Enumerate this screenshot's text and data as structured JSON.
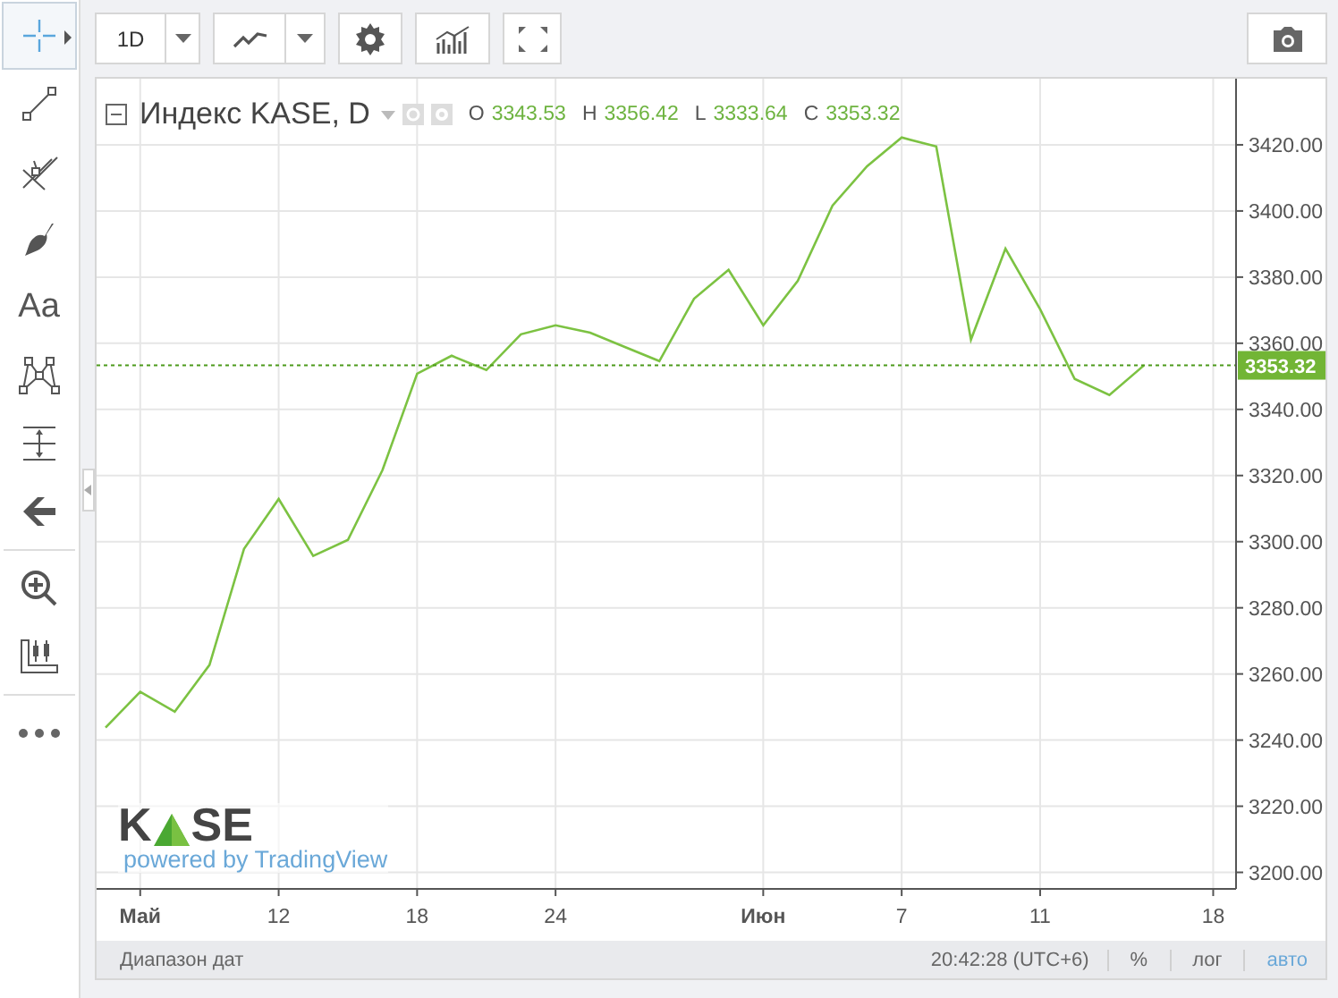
{
  "drawing_tools": [
    {
      "kind": "crosshair",
      "selected": true
    },
    {
      "kind": "trend-line",
      "selected": false
    },
    {
      "kind": "pitchfork",
      "selected": false
    },
    {
      "kind": "brush",
      "selected": false
    },
    {
      "kind": "text",
      "label": "Aa",
      "selected": false
    },
    {
      "kind": "pattern",
      "selected": false
    },
    {
      "kind": "measure",
      "selected": false
    },
    {
      "kind": "arrow",
      "selected": false
    },
    {
      "kind": "separator"
    },
    {
      "kind": "zoom",
      "selected": false
    },
    {
      "kind": "candle-ruler",
      "selected": false
    },
    {
      "kind": "separator"
    },
    {
      "kind": "more",
      "selected": false
    }
  ],
  "toolbar": {
    "interval": "1D"
  },
  "legend": {
    "title": "Индекс KASE, D",
    "ohlc": [
      {
        "label": "O",
        "value": "3343.53"
      },
      {
        "label": "H",
        "value": "3356.42"
      },
      {
        "label": "L",
        "value": "3333.64"
      },
      {
        "label": "C",
        "value": "3353.32"
      }
    ]
  },
  "logo": {
    "left": "K",
    "right": "SE",
    "tagline": "powered by TradingView"
  },
  "chart": {
    "chart_data": {
      "type": "line",
      "categories": [
        null,
        "Май",
        null,
        null,
        null,
        "12",
        null,
        null,
        null,
        "18",
        null,
        null,
        null,
        "24",
        null,
        null,
        null,
        null,
        null,
        "Июн",
        null,
        null,
        null,
        "7",
        null,
        null,
        null,
        "11",
        null,
        null,
        null,
        null,
        "18"
      ],
      "series": [
        {
          "color": "#7cc242",
          "values": [
            3243.8,
            3254.6,
            3248.6,
            3262.7,
            3297.8,
            3312.9,
            3295.7,
            3300.5,
            3321.6,
            3350.8,
            3356.2,
            3351.9,
            3362.7,
            3365.4,
            3363.2,
            3358.9,
            3354.6,
            3373.5,
            3382.2,
            3365.4,
            3378.9,
            3401.6,
            3413.5,
            3422.2,
            3419.5,
            3361.1,
            3388.6,
            3370.3,
            3349.2,
            3344.3,
            3353.3,
            null,
            null
          ]
        }
      ],
      "ylim": [
        3195,
        3440
      ],
      "grid": true,
      "ref_lines": [
        {
          "axis": "y",
          "value": 3353.32,
          "label": "3353.32",
          "color": "#4c9a1a"
        }
      ],
      "yticks": [
        {
          "value": 3200,
          "label": "3200.00"
        },
        {
          "value": 3220,
          "label": "3220.00"
        },
        {
          "value": 3240,
          "label": "3240.00"
        },
        {
          "value": 3260,
          "label": "3260.00"
        },
        {
          "value": 3280,
          "label": "3280.00"
        },
        {
          "value": 3300,
          "label": "3300.00"
        },
        {
          "value": 3320,
          "label": "3320.00"
        },
        {
          "value": 3340,
          "label": "3340.00"
        },
        {
          "value": 3360,
          "label": "3360.00"
        },
        {
          "value": 3380,
          "label": "3380.00"
        },
        {
          "value": 3400,
          "label": "3400.00"
        },
        {
          "value": 3420,
          "label": "3420.00"
        }
      ]
    }
  },
  "status_bar": {
    "date_range": "Диапазон дат",
    "time": "20:42:28 (UTC+6)",
    "scale_options": [
      {
        "label": "%",
        "selected": false
      },
      {
        "label": "лог",
        "selected": false
      },
      {
        "label": "авто",
        "selected": true
      }
    ]
  }
}
